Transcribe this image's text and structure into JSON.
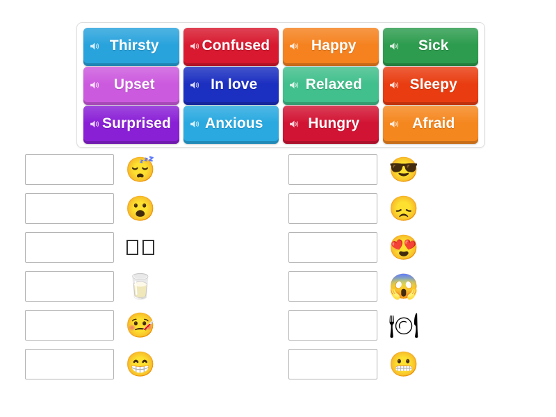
{
  "activity": {
    "type": "match-up",
    "word_bank": {
      "rows": [
        [
          {
            "label": "Thirsty",
            "color": "#29a3dc",
            "icon": "speaker-icon"
          },
          {
            "label": "Confused",
            "color": "#d8192f",
            "icon": "speaker-icon"
          },
          {
            "label": "Happy",
            "color": "#f5821f",
            "icon": "speaker-icon"
          },
          {
            "label": "Sick",
            "color": "#2d9c4e",
            "icon": "speaker-icon"
          }
        ],
        [
          {
            "label": "Upset",
            "color": "#cc5ade",
            "icon": "speaker-icon"
          },
          {
            "label": "In love",
            "color": "#1b2fc0",
            "icon": "speaker-icon"
          },
          {
            "label": "Relaxed",
            "color": "#41bf8c",
            "icon": "speaker-icon"
          },
          {
            "label": "Sleepy",
            "color": "#e93d11",
            "icon": "speaker-icon"
          }
        ],
        [
          {
            "label": "Surprised",
            "color": "#8a20d6",
            "icon": "speaker-icon"
          },
          {
            "label": "Anxious",
            "color": "#29a9e0",
            "icon": "speaker-icon"
          },
          {
            "label": "Hungry",
            "color": "#d21434",
            "icon": "speaker-icon"
          },
          {
            "label": "Afraid",
            "color": "#f5871f",
            "icon": "speaker-icon"
          }
        ]
      ]
    },
    "answer_area": {
      "left_column": [
        {
          "answer": "",
          "emoji": "😴",
          "emoji_name": "sleeping-face-emoji"
        },
        {
          "answer": "",
          "emoji": "😮",
          "emoji_name": "face-with-open-mouth-emoji"
        },
        {
          "answer": "",
          "emoji": "",
          "emoji_name": "missing-glyph-tofu"
        },
        {
          "answer": "",
          "emoji": "🥛",
          "emoji_name": "glass-of-milk-emoji"
        },
        {
          "answer": "",
          "emoji": "🤒",
          "emoji_name": "face-with-thermometer-emoji"
        },
        {
          "answer": "",
          "emoji": "😁",
          "emoji_name": "beaming-face-emoji"
        }
      ],
      "right_column": [
        {
          "answer": "",
          "emoji": "😎",
          "emoji_name": "smiling-face-with-sunglasses-emoji"
        },
        {
          "answer": "",
          "emoji": "😞",
          "emoji_name": "disappointed-face-emoji"
        },
        {
          "answer": "",
          "emoji": "😍",
          "emoji_name": "smiling-face-with-heart-eyes-emoji"
        },
        {
          "answer": "",
          "emoji": "😱",
          "emoji_name": "face-screaming-in-fear-emoji"
        },
        {
          "answer": "",
          "emoji": "🍽",
          "emoji_name": "fork-and-knife-with-plate-emoji"
        },
        {
          "answer": "",
          "emoji": "😬",
          "emoji_name": "grimacing-face-emoji"
        }
      ]
    }
  }
}
